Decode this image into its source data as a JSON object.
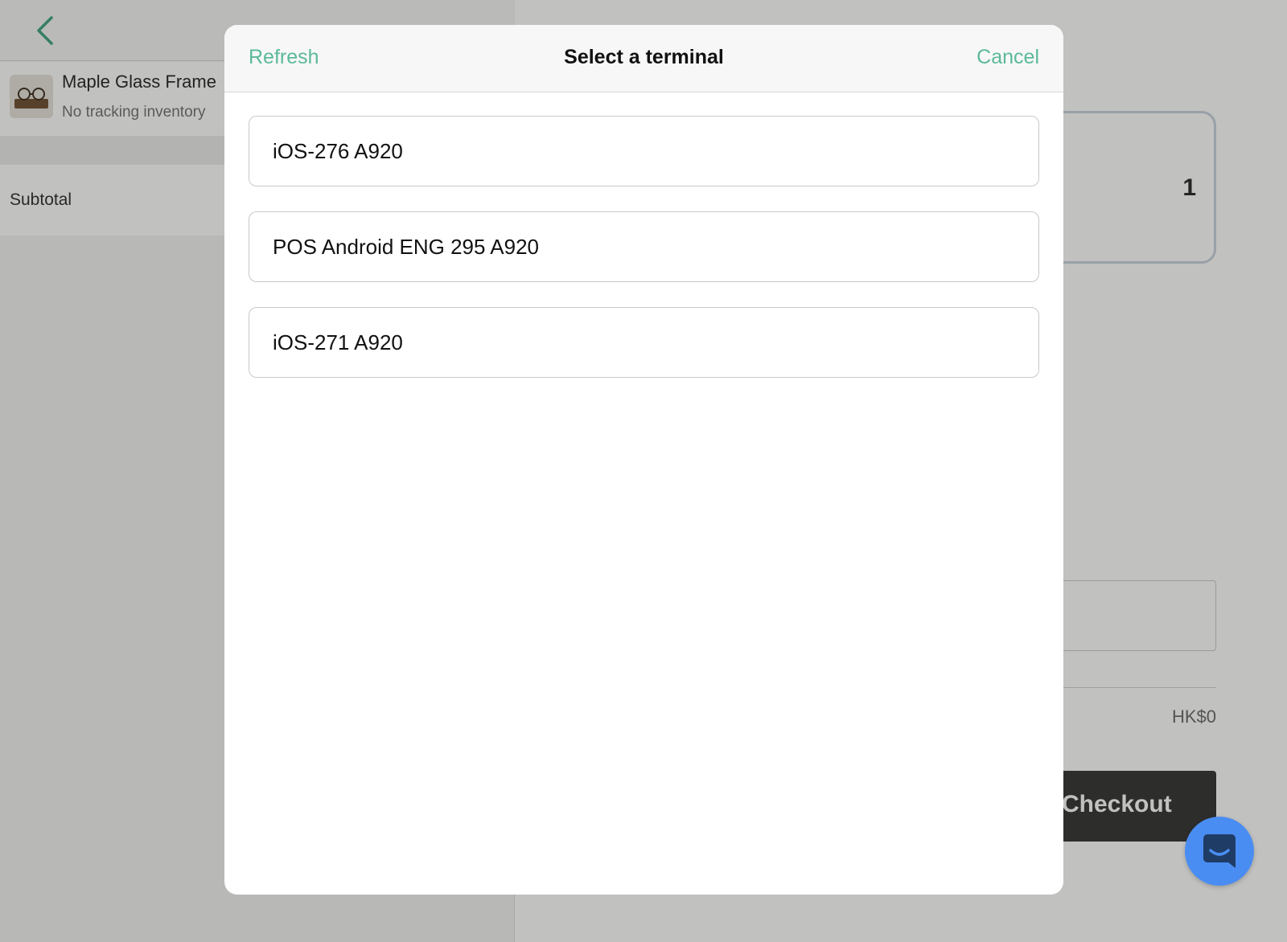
{
  "background": {
    "cart_item": {
      "name": "Maple Glass Frame",
      "subtitle": "No tracking inventory"
    },
    "subtotal_label": "Subtotal",
    "quantity": "1",
    "total_value": "HK$0",
    "checkout_label": "Checkout"
  },
  "modal": {
    "title": "Select a terminal",
    "refresh_label": "Refresh",
    "cancel_label": "Cancel",
    "terminals": [
      {
        "name": "iOS-276 A920"
      },
      {
        "name": "POS Android ENG 295 A920"
      },
      {
        "name": "iOS-271 A920"
      }
    ]
  },
  "colors": {
    "accent": "#5bb99a",
    "chat_button": "#4a8df2",
    "checkout_button": "#2f2f2f"
  },
  "icons": {
    "back": "chevron-left-icon",
    "chat": "chat-bubble-icon"
  }
}
